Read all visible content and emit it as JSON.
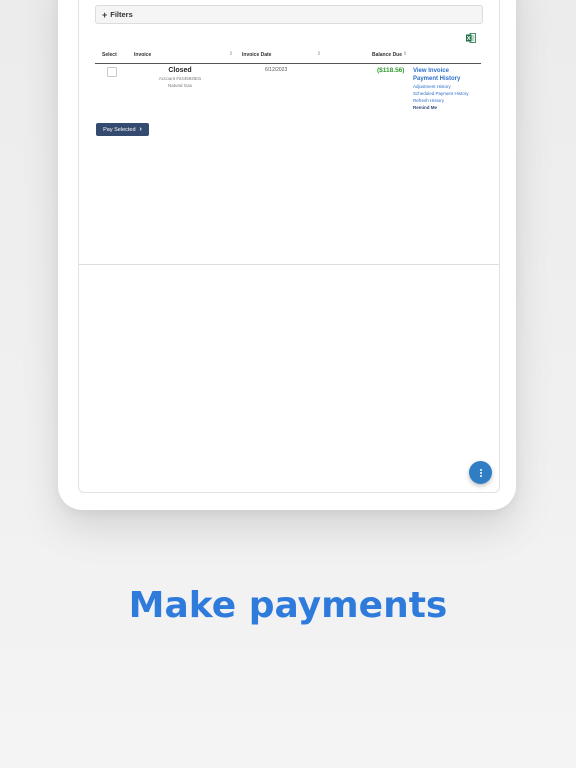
{
  "filters": {
    "label": "Filters"
  },
  "table": {
    "headers": {
      "select": "Select",
      "invoice": "Invoice",
      "invoice_date": "Invoice Date",
      "balance_due": "Balance Due"
    },
    "rows": [
      {
        "status": "Closed",
        "account": "Account #244592501",
        "service": "Natural Gas",
        "invoice_date": "6/12/2023",
        "balance": "($118.56)",
        "links": {
          "view_invoice": "View Invoice",
          "payment_history": "Payment History",
          "adjustment_history": "Adjustment History",
          "scheduled_payment_history": "Scheduled Payment History",
          "refresh_history": "Refresh History",
          "remind_me": "Remind Me"
        }
      }
    ]
  },
  "actions": {
    "pay_selected": "Pay Selected"
  },
  "headline": "Make payments",
  "icons": {
    "excel": "excel-export-icon",
    "fab": "more-vertical-icon"
  },
  "colors": {
    "accent": "#2e7bdc",
    "button": "#344a6e",
    "balance": "#2e9a2e",
    "link": "#2d6ec9",
    "fab": "#2f7ec4"
  }
}
